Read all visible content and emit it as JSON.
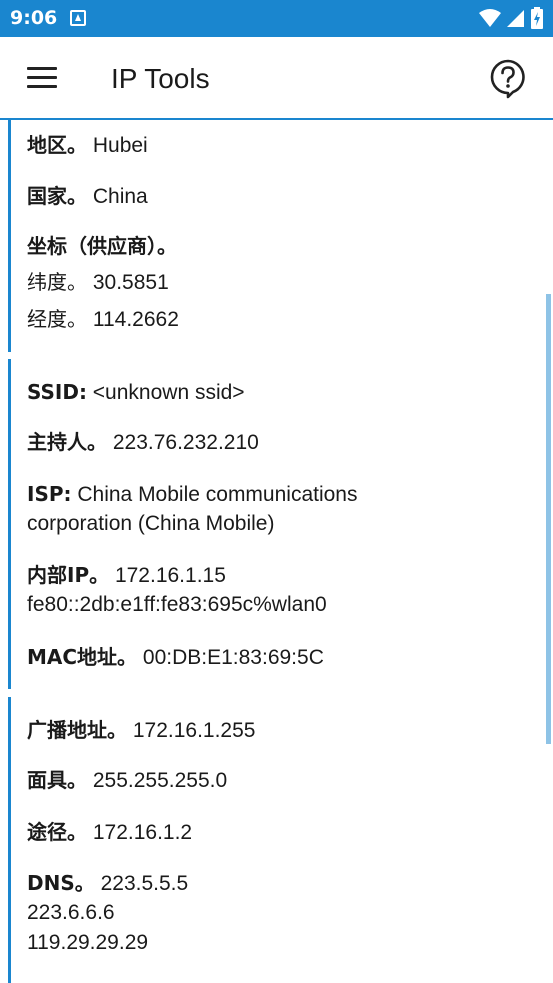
{
  "status_bar": {
    "time": "9:06"
  },
  "app_bar": {
    "title": "IP Tools"
  },
  "section1": {
    "region_label": "地区。",
    "region_value": "Hubei",
    "country_label": "国家。",
    "country_value": "China",
    "coords_label": "坐标（供应商）。",
    "lat_label": "纬度。",
    "lat_value": "30.5851",
    "lon_label": "经度。",
    "lon_value": "114.2662"
  },
  "section2": {
    "ssid_label": "SSID:",
    "ssid_value": "<unknown ssid>",
    "host_label": "主持人。",
    "host_value": "223.76.232.210",
    "isp_label": "ISP:",
    "isp_value_line1": "China Mobile communications",
    "isp_value_line2": "corporation (China Mobile)",
    "internal_ip_label": "内部IP。",
    "internal_ip_value": "172.16.1.15",
    "internal_ip_v6": "fe80::2db:e1ff:fe83:695c%wlan0",
    "mac_label": "MAC地址。",
    "mac_value": "00:DB:E1:83:69:5C"
  },
  "section3": {
    "broadcast_label": "广播地址。",
    "broadcast_value": "172.16.1.255",
    "mask_label": "面具。",
    "mask_value": "255.255.255.0",
    "route_label": "途径。",
    "route_value": "172.16.1.2",
    "dns_label": "DNS。",
    "dns_values": [
      "223.5.5.5",
      "223.6.6.6",
      "119.29.29.29"
    ]
  },
  "colors": {
    "accent": "#1a86cf",
    "scrollbar": "#8ec3e6"
  },
  "icons": [
    "menu-icon",
    "help-bubble-icon",
    "wifi-icon",
    "signal-icon",
    "battery-icon",
    "notification-icon"
  ]
}
